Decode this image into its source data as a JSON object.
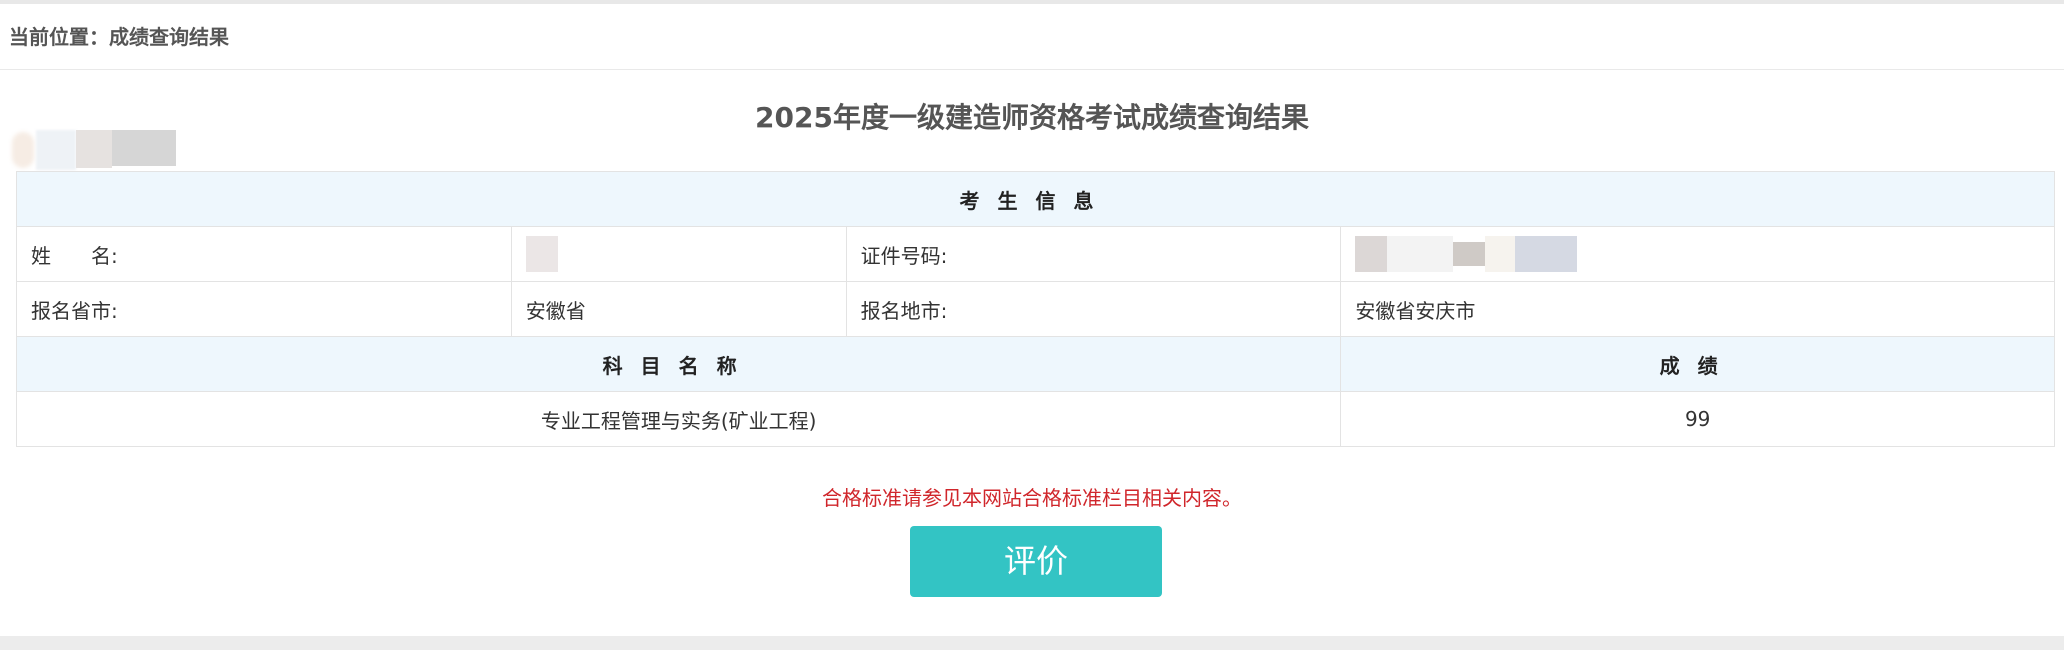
{
  "breadcrumb": {
    "text": "当前位置：成绩查询结果"
  },
  "title": "2025年度一级建造师资格考试成绩查询结果",
  "table": {
    "section_header": "考生信息",
    "name_label": "姓　　名:",
    "name_value": "",
    "id_label": "证件号码:",
    "id_value": "",
    "province_label": "报名省市:",
    "province_value": "安徽省",
    "city_label": "报名地市:",
    "city_value": "安徽省安庆市",
    "subject_header": "科目名称",
    "score_header": "成绩",
    "rows": [
      {
        "subject": "专业工程管理与实务(矿业工程)",
        "score": "99"
      }
    ]
  },
  "note": "合格标准请参见本网站合格标准栏目相关内容。",
  "eval_button": "评价",
  "colors": {
    "accent": "#33c4c4",
    "note": "#d0262b",
    "header_bg": "#eef7fd"
  }
}
